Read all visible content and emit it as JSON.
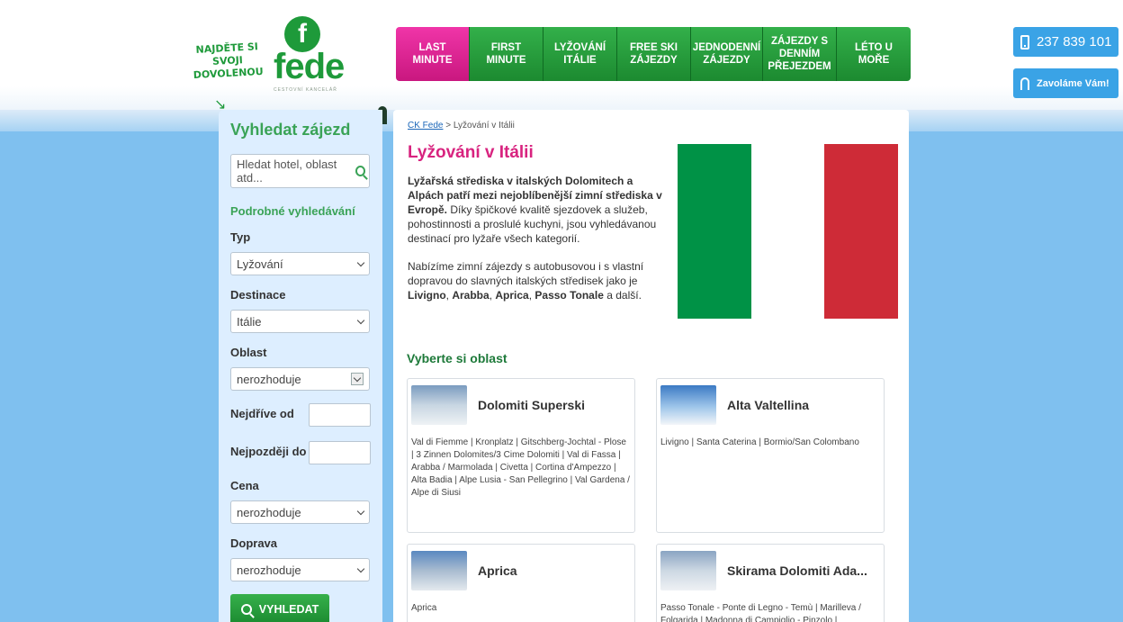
{
  "brand": {
    "tagline": "NAJDĚTE SI SVOJI DOVOLENOU",
    "logo_letter": "f",
    "logo_word": "fede",
    "logo_sub": "CESTOVNÍ KANCELÁŘ"
  },
  "nav": [
    {
      "label": "LAST MINUTE"
    },
    {
      "label": "FIRST MINUTE"
    },
    {
      "label": "LYŽOVÁNÍ ITÁLIE"
    },
    {
      "label": "FREE SKI ZÁJEZDY"
    },
    {
      "label": "JEDNODENNÍ ZÁJEZDY"
    },
    {
      "label": "ZÁJEZDY S DENNÍM PŘEJEZDEM"
    },
    {
      "label": "LÉTO U MOŘE"
    }
  ],
  "contact": {
    "phone": "237 839 101",
    "callback": "Zavoláme Vám!"
  },
  "sidebar": {
    "title": "Vyhledat zájezd",
    "search_placeholder": "Hledat hotel, oblast atd...",
    "advanced": "Podrobné vyhledávání",
    "type_label": "Typ",
    "type_value": "Lyžování",
    "dest_label": "Destinace",
    "dest_value": "Itálie",
    "area_label": "Oblast",
    "area_value": "nerozhoduje",
    "from_label": "Nejdříve od",
    "to_label": "Nejpozději do",
    "price_label": "Cena",
    "price_value": "nerozhoduje",
    "transport_label": "Doprava",
    "transport_value": "nerozhoduje",
    "button": "VYHLEDAT"
  },
  "main": {
    "crumb_link": "CK Fede",
    "crumb_rest": " > Lyžování v Itálii",
    "title": "Lyžování v Itálii",
    "intro_bold": "Lyžařská střediska v italských Dolomitech a Alpách patří mezi nejoblíbenější zimní střediska v Evropě.",
    "intro_rest": " Díky špičkové kvalitě sjezdovek a služeb, pohostinnosti a proslulé kuchyni, jsou vyhledávanou destinací pro lyžaře všech kategorií.",
    "p2_start": "Nabízíme zimní zájezdy s autobusovou i s vlastní dopravou do slavných italských středisek jako je ",
    "p2_b1": "Livigno",
    "p2_s1": ", ",
    "p2_b2": "Arabba",
    "p2_s2": ", ",
    "p2_b3": "Aprica",
    "p2_s3": ", ",
    "p2_b4": "Passo Tonale",
    "p2_end": " a další.",
    "subhead": "Vyberte si oblast",
    "cards": [
      {
        "title": "Dolomiti Superski",
        "text": "Val di Fiemme | Kronplatz | Gitschberg-Jochtal - Plose | 3 Zinnen Dolomites/3 Cime Dolomiti | Val di Fassa | Arabba / Marmolada | Civetta | Cortina d'Ampezzo | Alta Badia | Alpe Lusia - San Pellegrino | Val Gardena / Alpe di Siusi"
      },
      {
        "title": "Alta Valtellina",
        "text": "Livigno | Santa Caterina | Bormio/San Colombano"
      },
      {
        "title": "Aprica",
        "text": "Aprica"
      },
      {
        "title": "Skirama Dolomiti Ada...",
        "text": "Passo Tonale - Ponte di Legno - Temù | Marilleva / Folgarida | Madonna di Campiglio - Pinzolo |"
      }
    ]
  },
  "colors": {
    "flag_green": "#009246",
    "flag_white": "#ffffff",
    "flag_red": "#ce2b37",
    "accent_pink": "#d8237f",
    "brand_green": "#1e9a3a"
  }
}
